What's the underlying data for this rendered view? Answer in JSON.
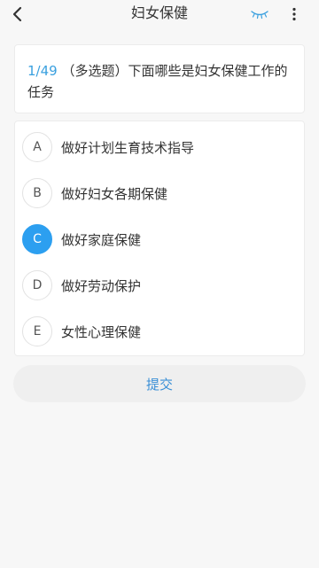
{
  "header": {
    "title": "妇女保健",
    "back_icon": "chevron-left-icon",
    "eye_icon": "eye-closed-icon",
    "more_icon": "more-vertical-icon"
  },
  "question": {
    "index": "1/49",
    "text": " （多选题）下面哪些是妇女保健工作的任务"
  },
  "options": [
    {
      "letter": "A",
      "label": "做好计划生育技术指导",
      "selected": false
    },
    {
      "letter": "B",
      "label": "做好妇女各期保健",
      "selected": false
    },
    {
      "letter": "C",
      "label": "做好家庭保健",
      "selected": true
    },
    {
      "letter": "D",
      "label": "做好劳动保护",
      "selected": false
    },
    {
      "letter": "E",
      "label": "女性心理保健",
      "selected": false
    }
  ],
  "submit": {
    "label": "提交"
  },
  "colors": {
    "accent": "#2c9ff0",
    "index_blue": "#3aa0df",
    "submit_text": "#3a8fd6",
    "background": "#f7f7f7"
  }
}
